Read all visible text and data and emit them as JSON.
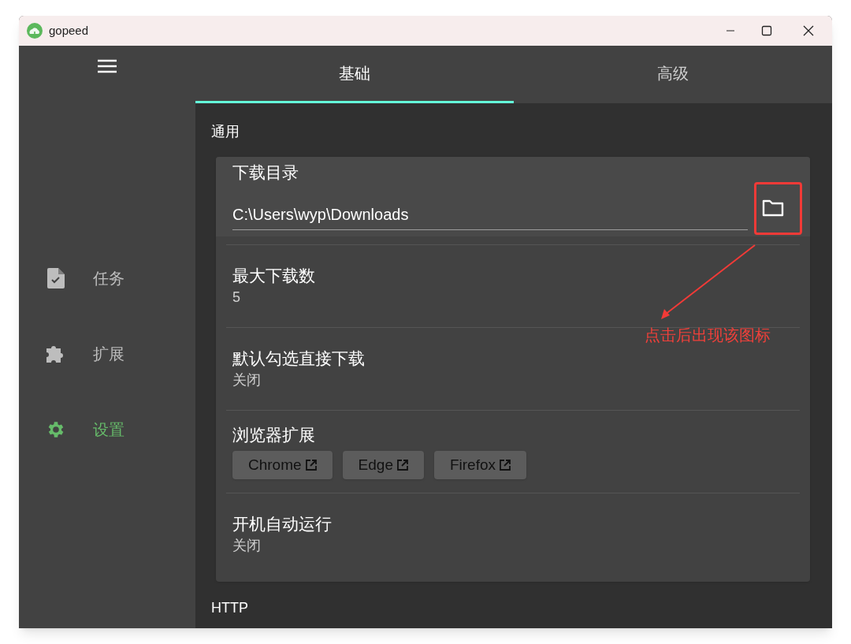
{
  "window": {
    "title": "gopeed"
  },
  "sidebar": {
    "items": [
      {
        "label": "任务",
        "kind": "task",
        "selected": false
      },
      {
        "label": "扩展",
        "kind": "extension",
        "selected": false
      },
      {
        "label": "设置",
        "kind": "settings",
        "selected": true
      }
    ]
  },
  "tabs": [
    {
      "label": "基础",
      "selected": true
    },
    {
      "label": "高级",
      "selected": false
    }
  ],
  "sections": [
    {
      "title": "通用",
      "items": [
        {
          "kind": "path",
          "label": "下载目录",
          "value": "C:\\Users\\wyp\\Downloads"
        },
        {
          "kind": "text",
          "label": "最大下载数",
          "value": "5"
        },
        {
          "kind": "text",
          "label": "默认勾选直接下载",
          "value": "关闭"
        },
        {
          "kind": "buttons",
          "label": "浏览器扩展",
          "buttons": [
            "Chrome",
            "Edge",
            "Firefox"
          ]
        },
        {
          "kind": "text",
          "label": "开机自动运行",
          "value": "关闭"
        }
      ]
    },
    {
      "title": "HTTP"
    }
  ],
  "annotation": {
    "text": "点击后出现该图标"
  }
}
